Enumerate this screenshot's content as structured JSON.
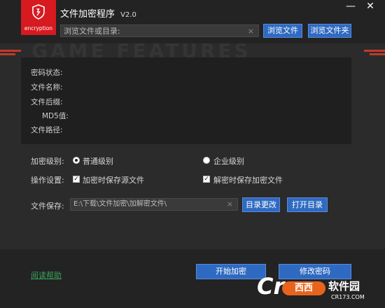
{
  "app": {
    "logo_text": "encryption",
    "title": "文件加密程序",
    "version": "V2.0"
  },
  "window_controls": {
    "minimize_glyph": "—",
    "close_glyph": "✕"
  },
  "browse": {
    "placeholder": "浏览文件或目录:",
    "clear_glyph": "×",
    "browse_file_label": "浏览文件",
    "browse_folder_label": "浏览文件夹"
  },
  "banner": {
    "text": "GAME FEATURES"
  },
  "info": {
    "password_status_label": "密码状态:",
    "file_name_label": "文件名称:",
    "file_ext_label": "文件后缀:",
    "md5_label": "MD5值:",
    "file_path_label": "文件路径:"
  },
  "options": {
    "level_label": "加密级别:",
    "level_normal": "普通级别",
    "level_enterprise": "企业级别",
    "selected_level": "普通级别",
    "settings_label": "操作设置:",
    "keep_source_on_encrypt": "加密时保存源文件",
    "keep_encrypted_on_decrypt": "解密时保存加密文件",
    "keep_source_checked": true,
    "keep_encrypted_checked": true
  },
  "save": {
    "label": "文件保存:",
    "path": "E:\\下载\\文件加密\\加解密文件\\",
    "clear_glyph": "×",
    "change_dir_label": "目录更改",
    "open_dir_label": "打开目录"
  },
  "footer": {
    "help_label": "阅读帮助",
    "start_encrypt_label": "开始加密",
    "change_password_label": "修改密码"
  },
  "watermark": {
    "cr": "Cr",
    "badge": "西西",
    "name": "软件园",
    "url": "CR173.COM"
  },
  "colors": {
    "accent_red": "#d71920",
    "button_blue": "#2f6ac2",
    "help_green": "#3aa35a",
    "panel_dark": "#1f1f1f"
  }
}
